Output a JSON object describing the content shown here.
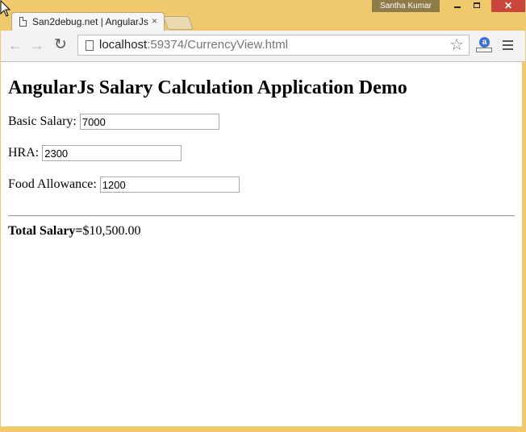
{
  "window": {
    "profile_name": "Santha Kumar",
    "minimize": "—",
    "maximize": "□",
    "close": "✕"
  },
  "tab": {
    "title": "San2debug.net | AngularJs",
    "close": "×"
  },
  "toolbar": {
    "back": "←",
    "forward": "→",
    "reload": "↻",
    "url_host": "localhost",
    "url_path": ":59374/CurrencyView.html",
    "star": "☆",
    "extension_letter": "a"
  },
  "page": {
    "heading": "AngularJs Salary Calculation Application Demo",
    "fields": [
      {
        "label": "Basic Salary:",
        "value": "7000"
      },
      {
        "label": "HRA:",
        "value": "2300"
      },
      {
        "label": "Food Allowance:",
        "value": "1200"
      }
    ],
    "total_label": "Total Salary=",
    "total_value": "$10,500.00"
  },
  "colors": {
    "frame": "#f1c96d",
    "close_button": "#c9463d",
    "profile_badge": "#8f7a4a"
  }
}
